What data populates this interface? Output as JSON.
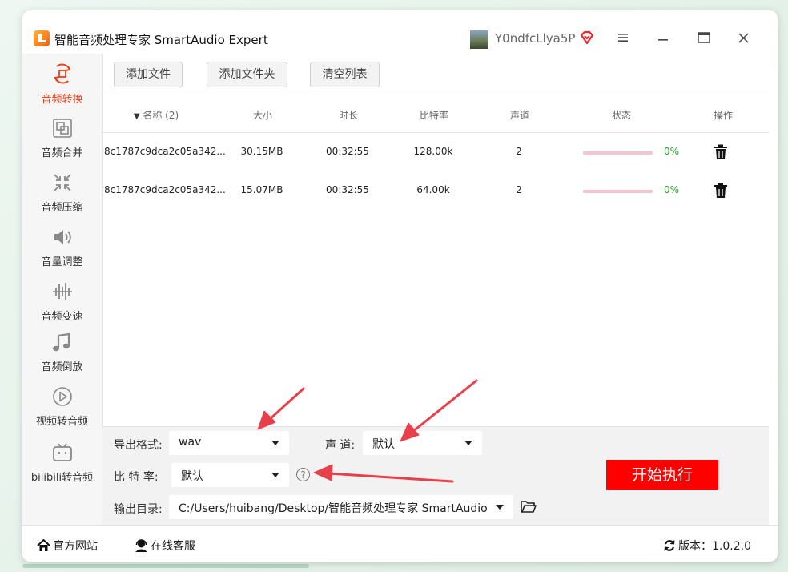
{
  "app": {
    "title": "智能音频处理专家 SmartAudio Expert",
    "username": "Y0ndfcLlya5P"
  },
  "sidebar": {
    "items": [
      {
        "label": "音频转换",
        "icon": "convert-icon",
        "active": true
      },
      {
        "label": "音频合并",
        "icon": "merge-icon"
      },
      {
        "label": "音频压缩",
        "icon": "compress-icon"
      },
      {
        "label": "音量调整",
        "icon": "volume-icon"
      },
      {
        "label": "音频变速",
        "icon": "speed-icon"
      },
      {
        "label": "音频倒放",
        "icon": "music-note-icon"
      },
      {
        "label": "视频转音频",
        "icon": "play-icon"
      },
      {
        "label": "bilibili转音频",
        "icon": "bilibili-icon"
      }
    ]
  },
  "toolbar": {
    "add_file": "添加文件",
    "add_folder": "添加文件夹",
    "clear_list": "清空列表"
  },
  "table": {
    "headers": {
      "name": "名称 (2)",
      "size": "大小",
      "duration": "时长",
      "bitrate": "比特率",
      "channel": "声道",
      "status": "状态",
      "action": "操作"
    },
    "rows": [
      {
        "name": "8c1787c9dca2c05a342...",
        "size": "30.15MB",
        "duration": "00:32:55",
        "bitrate": "128.00k",
        "channel": "2",
        "progress": 0,
        "progress_text": "0%"
      },
      {
        "name": "8c1787c9dca2c05a342...",
        "size": "15.07MB",
        "duration": "00:32:55",
        "bitrate": "64.00k",
        "channel": "2",
        "progress": 0,
        "progress_text": "0%"
      }
    ]
  },
  "settings": {
    "format_label": "导出格式:",
    "format_value": "wav",
    "channel_label": "声 道:",
    "channel_value": "默认",
    "bitrate_label": "比 特 率:",
    "bitrate_value": "默认",
    "output_label": "输出目录:",
    "output_value": "C:/Users/huibang/Desktop/智能音频处理专家 SmartAudio",
    "start_button": "开始执行"
  },
  "statusbar": {
    "website": "官方网站",
    "support": "在线客服",
    "version": "版本：1.0.2.0"
  },
  "colors": {
    "accent": "#e8421a",
    "start_button": "#ff0000",
    "progress_track": "#f6c3d0",
    "progress_text": "#2a9a2a",
    "annotation_arrow": "#e8404a"
  }
}
